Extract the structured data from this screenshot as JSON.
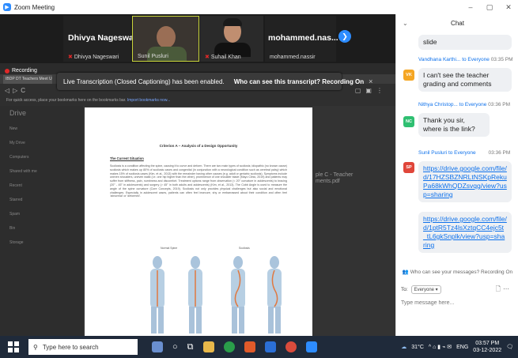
{
  "window": {
    "title": "Zoom Meeting",
    "min": "–",
    "max": "▢",
    "close": "✕"
  },
  "participants": [
    {
      "display_name": "Dhivya Nageswari",
      "sub": "Dhivya Nageswari"
    },
    {
      "display_name": "",
      "sub": "Sunil Pusluri"
    },
    {
      "display_name": "",
      "sub": "Suhail Khan"
    },
    {
      "display_name": "mohammed.nas...",
      "sub": "mohammed.nassir"
    }
  ],
  "recording": {
    "label": "Recording"
  },
  "banner": {
    "text": "Live Transcription (Closed Captioning) has been enabled.",
    "action": "Who can see this transcript? Recording On",
    "close": "×"
  },
  "browser": {
    "tab_label": "IBDP DT Teachers Meet Up",
    "bookmarks_text": "For quick access, place your bookmarks here on the bookmarks bar.",
    "bookmarks_link": "Import bookmarks now..."
  },
  "drive": {
    "logo": "Drive",
    "side_items": [
      "New",
      "My Drive",
      "Computers",
      "Shared with me",
      "Recent",
      "Starred",
      "Spam",
      "Bin",
      "Storage"
    ],
    "right_file": "ple C - Teacher ments.pdf"
  },
  "document": {
    "title": "Criterion A – Analysis of a Design Opportunity",
    "heading": "The Current Situation",
    "paragraph": "Scoliosis is a condition affecting the spine, causing it to curve and deform. There are two main types of scoliosis; idiopathic (no known cause) scoliosis which makes up 80% of scoliosis cases and congenital (in conjunction with a neurological condition such as cerebral palsy) which makes 15% of scoliosis cases (Kim, et al., 2013) with the remainder having other causes (e.g. adult or geriatric scoliosis). Symptoms include uneven shoulders, uneven waist (i.e. one hip higher than the other), prominence of one shoulder blade (Mayo Clinic, 2019) and patients may suffer from stiffness, pain, numbness and discomfort. Treatment options range from observation (< 20° curvature in adolescents) to bracing (20° - 45° in adolescents) and surgery (> 45° in both adults and adolescents) (Kim, et al., 2013). The Cobb Angle is used to measure the angle of the spine curvature (Core Concepts, 2019). Scoliosis not only provides physical challenges but also social and emotional challenges. Especially in adolescent cases, patients can often feel insecure, shy or embarrassed about their condition and often feel 'abnormal' or 'deformed'.",
    "figure_labels": [
      "Normal Spine",
      "Scoliosis"
    ]
  },
  "chat": {
    "title": "Chat",
    "messages": [
      {
        "from": "",
        "to": "",
        "time": "",
        "initials": "",
        "color": "",
        "text": "slide"
      },
      {
        "from": "Vandhana Karthi...",
        "to": "to Everyone",
        "time": "03:35 PM",
        "initials": "VK",
        "color": "#f5a623",
        "text": "I can't see the teacher grading and comments"
      },
      {
        "from": "Nithya Christop...",
        "to": "to Everyone",
        "time": "03:36 PM",
        "initials": "NC",
        "color": "#2fbf71",
        "text": "Thank you sir, where is the link?"
      },
      {
        "from": "Sunil Pusluri",
        "to": "to Everyone",
        "time": "03:36 PM",
        "initials": "SP",
        "color": "#e0463a",
        "text": "https://drive.google.com/file/d/17HZSBZNRLtNSKpRekuPa68kWhQDZsvqg/view?usp=sharing"
      },
      {
        "from": "",
        "to": "",
        "time": "",
        "initials": "",
        "color": "",
        "text": "https://drive.google.com/file/d/1ptR5Tz4lsXztqCC4ejc5t_tL6gkSnplk/view?usp=sharing"
      }
    ],
    "footer_note": "Who can see your messages? Recording On",
    "to_label": "To:",
    "to_value": "Everyone ▾",
    "input_placeholder": "Type message here..."
  },
  "taskbar": {
    "search_placeholder": "Type here to search",
    "weather": "31°C",
    "lang": "ENG",
    "time": "03:57 PM",
    "date": "03-12-2022"
  },
  "colors": {
    "zoom_blue": "#2d8cff",
    "link_blue": "#0e71eb",
    "taskbar": "#1f2a3a"
  }
}
